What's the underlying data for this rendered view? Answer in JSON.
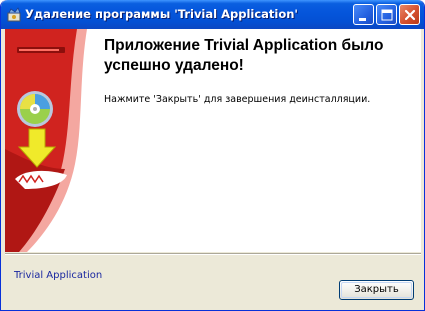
{
  "window": {
    "title": "Удаление программы 'Trivial Application'",
    "icon": "installer-icon",
    "controls": [
      "minimize-icon",
      "maximize-icon",
      "close-icon"
    ]
  },
  "main": {
    "heading": "Приложение Trivial Application было успешно удалено!",
    "info": "Нажмите 'Закрыть' для завершения деинсталляции."
  },
  "footer": {
    "brand": "Trivial Application",
    "close_label": "Закрыть"
  },
  "colors": {
    "titlebar": "#0556dc",
    "banner": "#c8201e",
    "brand_text": "#1a27a0"
  }
}
